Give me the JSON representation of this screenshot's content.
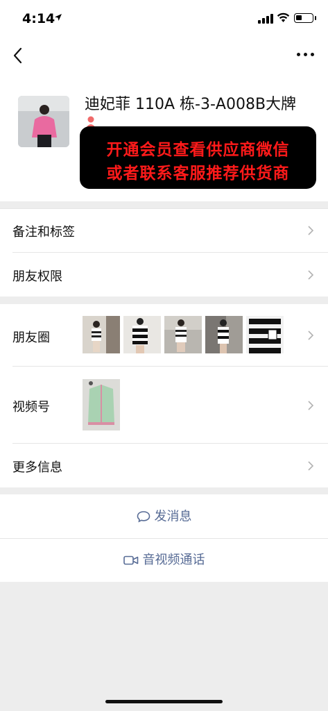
{
  "status_bar": {
    "time": "4:14"
  },
  "contact": {
    "name": "迪妃菲 110A 栋-3-A008B大牌",
    "banner_line1": "开通会员查看供应商微信",
    "banner_line2": "或者联系客服推荐供货商"
  },
  "rows": {
    "remarks_label": "备注和标签",
    "permissions_label": "朋友权限",
    "moments_label": "朋友圈",
    "channels_label": "视频号",
    "more_info_label": "更多信息"
  },
  "actions": {
    "send_message": "发消息",
    "av_call": "音视频通话"
  },
  "colors": {
    "link_blue": "#576b95",
    "banner_text_red": "#ff1a1a",
    "page_gray": "#ededed"
  },
  "icons": [
    "location-arrow-icon",
    "signal-icon",
    "wifi-icon",
    "battery-icon",
    "back-chevron-icon",
    "more-dots-icon",
    "female-gender-icon",
    "chevron-right-icon",
    "chat-bubble-icon",
    "video-camera-icon"
  ]
}
